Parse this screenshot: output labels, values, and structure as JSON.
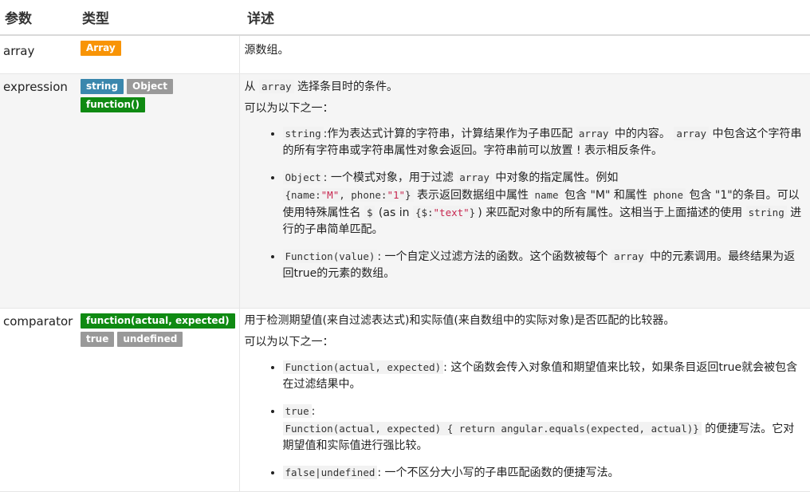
{
  "headers": {
    "param": "参数",
    "type": "类型",
    "detail": "详述"
  },
  "rows": [
    {
      "param": "array",
      "type_label": "Array",
      "desc": "源数组。"
    },
    {
      "param": "expression",
      "type_labels": [
        "string",
        "Object",
        "function()"
      ],
      "desc_intro_a": "从 ",
      "desc_intro_code": "array",
      "desc_intro_b": " 选择条目时的条件。",
      "desc_options": "可以为以下之一：",
      "items": [
        {
          "code": "string",
          "t1": ":作为表达式计算的字符串，计算结果作为子串匹配 ",
          "c2": "array",
          "t2": " 中的内容。 ",
          "c3": "array",
          "t3": " 中包含这个字符串的所有字符串或字符串属性对象会返回。字符串前可以放置 ! 表示相反条件。"
        },
        {
          "code": "Object",
          "t1": ": 一个模式对象，用于过滤 ",
          "c2": "array",
          "t2": " 中对象的指定属性。例如",
          "obj_a": "{name:",
          "obj_m": "\"M\"",
          "obj_b": ", phone:",
          "obj_1": "\"1\"",
          "obj_c": "}",
          "t3": " 表示返回数据组中属性 ",
          "c4": "name",
          "t4": " 包含 \"M\" 和属性 ",
          "c5": "phone",
          "t5": " 包含 \"1\"的条目。可以使用特殊属性名 ",
          "c6": "$",
          "t6": " (as in ",
          "c7a": "{$:",
          "c7s": "\"text\"",
          "c7b": "}",
          "t7": ") 来匹配对象中的所有属性。这相当于上面描述的使用 ",
          "c8": "string",
          "t8": " 进行的子串简单匹配。"
        },
        {
          "code": "Function(value)",
          "t1": ": 一个自定义过滤方法的函数。这个函数被每个 ",
          "c2": "array",
          "t2": " 中的元素调用。最终结果为返回true的元素的数组。"
        }
      ]
    },
    {
      "param": "comparator",
      "type_labels": [
        "function(actual, expected)",
        "true",
        "undefined"
      ],
      "desc_intro": "用于检测期望值(来自过滤表达式)和实际值(来自数组中的实际对象)是否匹配的比较器。",
      "desc_options": "可以为以下之一：",
      "items": [
        {
          "code": "Function(actual, expected)",
          "t1": ": 这个函数会传入对象值和期望值来比较，如果条目返回true就会被包含在过滤结果中。"
        },
        {
          "code": "true",
          "t1": ": ",
          "c2": "Function(actual, expected) { return angular.equals(expected, actual)}",
          "t2": " 的便捷写法。它对期望值和实际值进行强比较。"
        },
        {
          "code": "false|undefined",
          "t1": ": 一个不区分大小写的子串匹配函数的便捷写法。"
        }
      ]
    }
  ]
}
